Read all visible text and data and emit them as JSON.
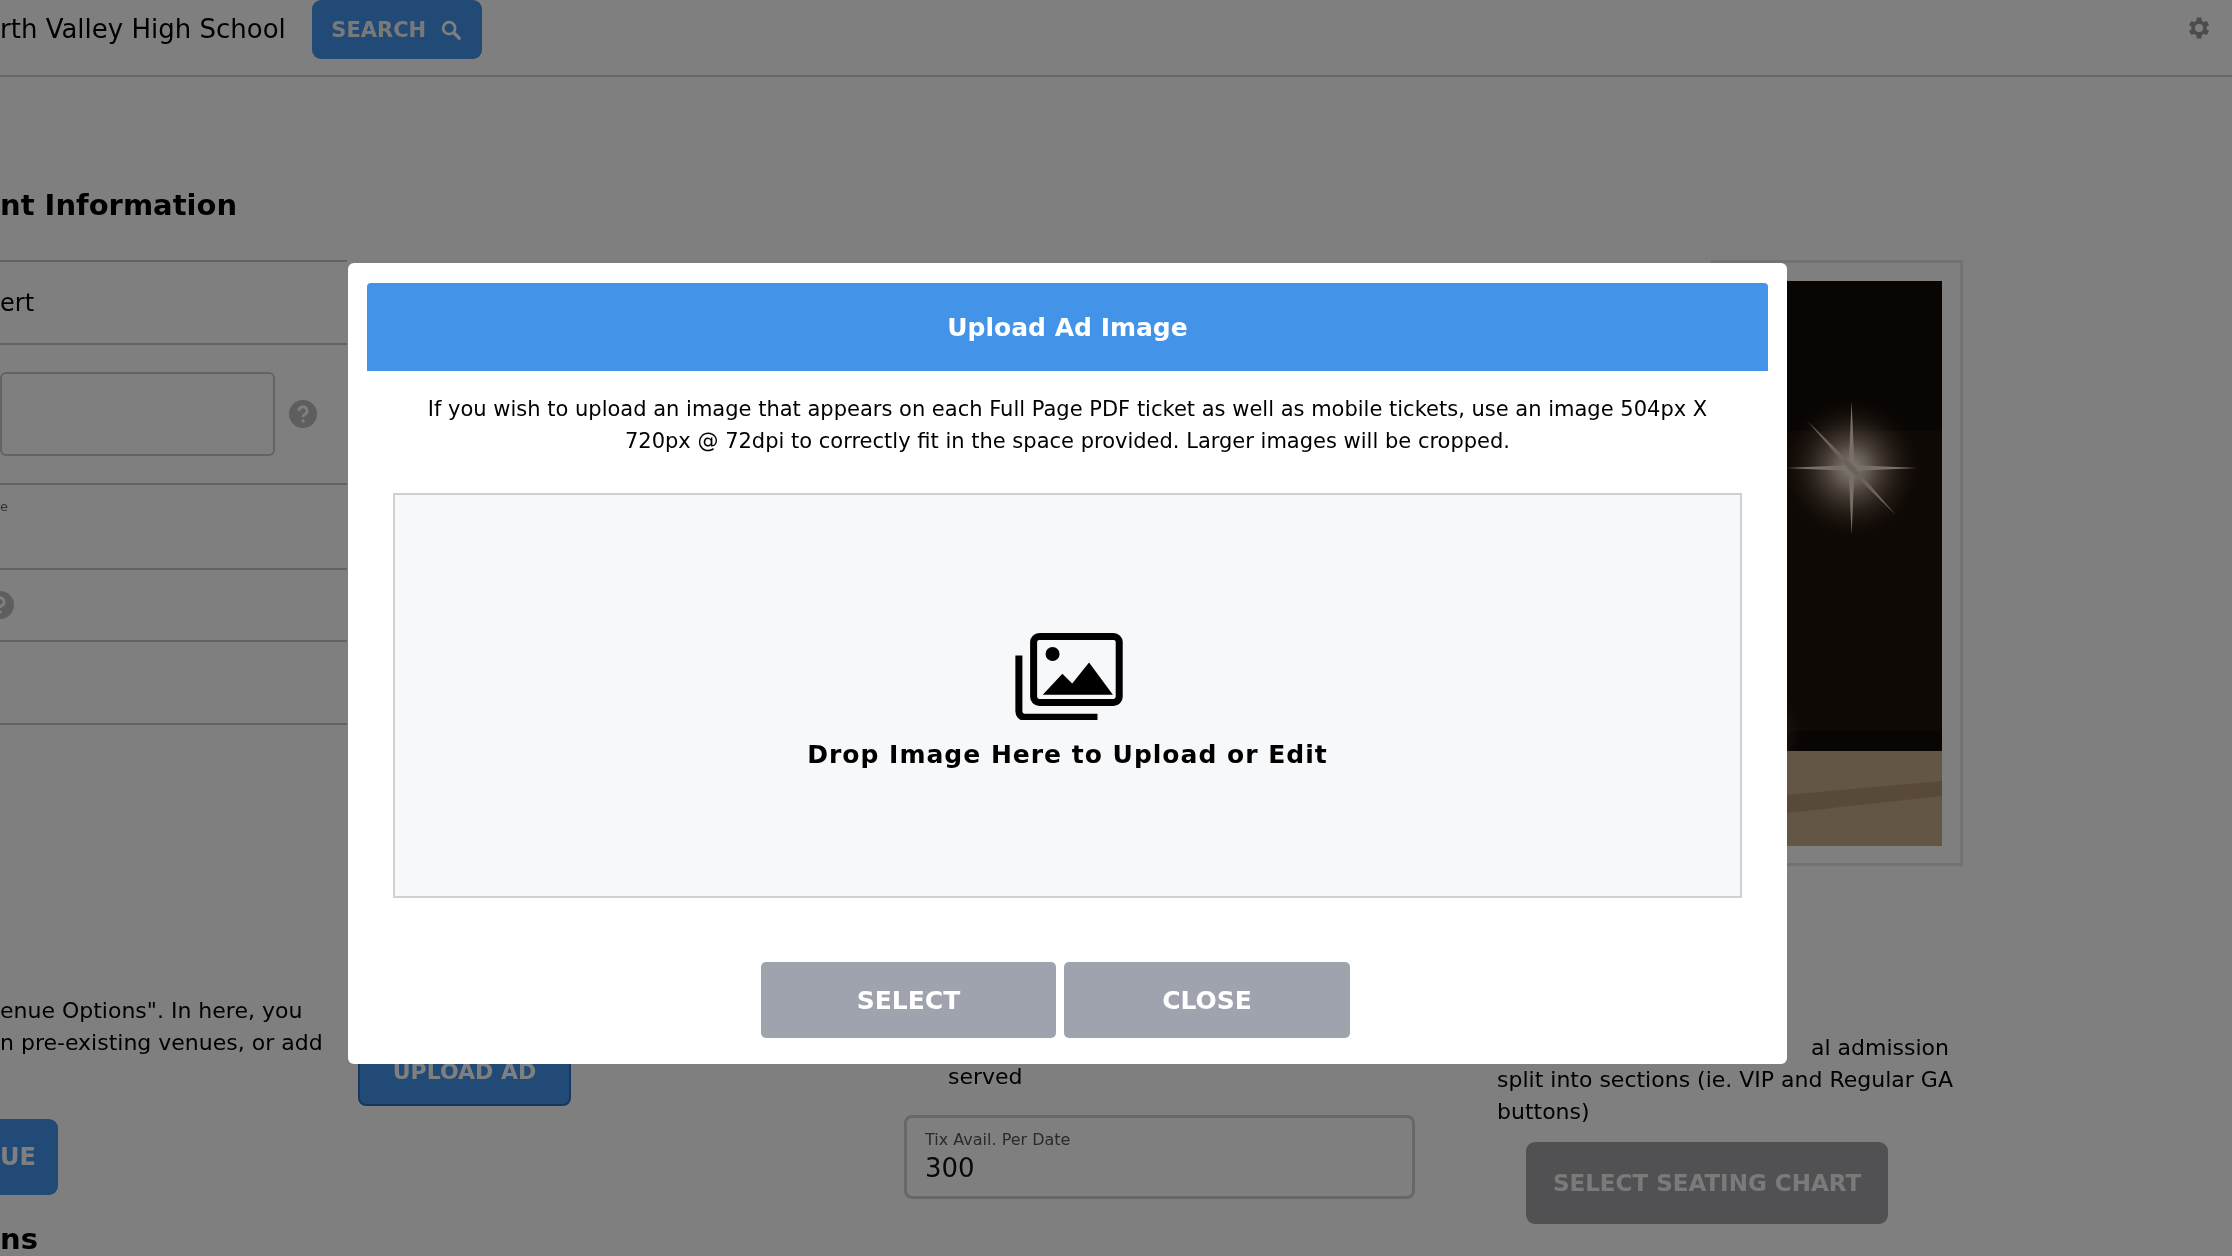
{
  "header": {
    "school_name": "rth Valley High School",
    "search_button": "SEARCH"
  },
  "section_heading": "nt Information",
  "form_left": {
    "field_value": "ert",
    "field_label": "e"
  },
  "venue_help_lines": [
    "enue Options\". In here, you",
    "n pre-existing venues, or add"
  ],
  "venue_button": "UE",
  "section_heading_2": "ns",
  "upload_ad_button": "UPLOAD AD",
  "served_text": "served",
  "tix_field": {
    "label": "Tix Avail. Per Date",
    "value": "300"
  },
  "seating_help_lines": [
    "al admission",
    "split into sections (ie. VIP and Regular GA",
    "buttons)"
  ],
  "seating_button": "SELECT SEATING CHART",
  "modal": {
    "title": "Upload Ad Image",
    "instructions": "If you wish to upload an image that appears on each Full Page PDF ticket as well as mobile tickets, use an image 504px X 720px @ 72dpi to correctly fit in the space provided. Larger images will be cropped.",
    "dropzone_text": "Drop Image Here to Upload or Edit",
    "buttons": [
      "SELECT",
      "CLOSE"
    ]
  }
}
